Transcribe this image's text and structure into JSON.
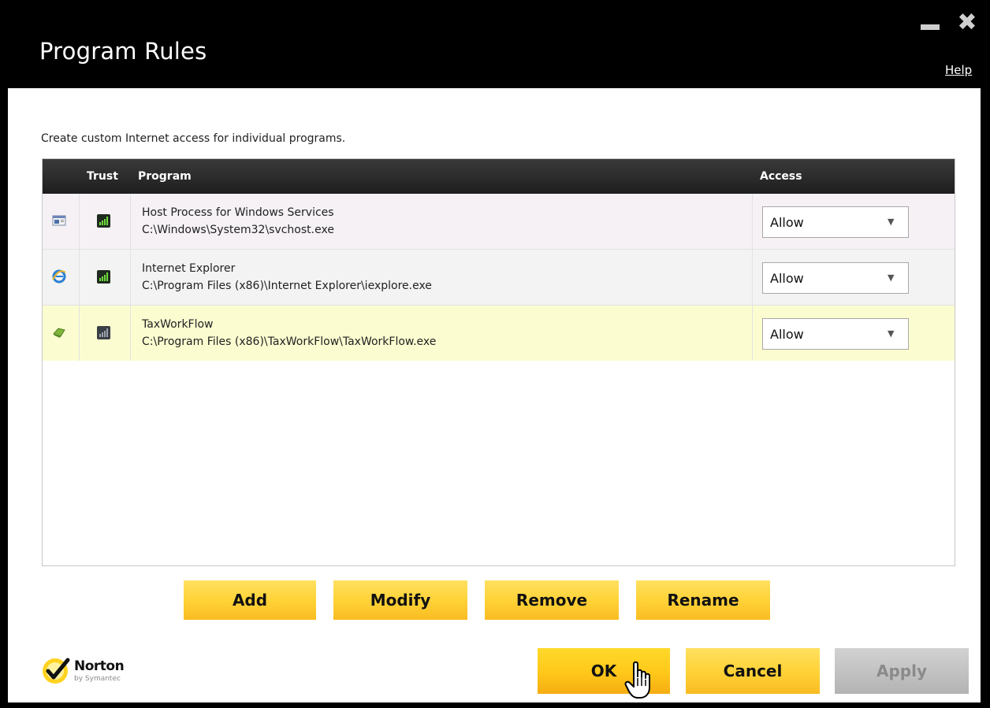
{
  "window": {
    "title": "Program Rules",
    "help_label": "Help",
    "minimize_label": "",
    "close_label": "✖"
  },
  "description": "Create custom Internet access for individual programs.",
  "table": {
    "columns": {
      "icon": "",
      "trust": "Trust",
      "program": "Program",
      "access": "Access"
    },
    "rows": [
      {
        "name": "Host Process for Windows Services",
        "path": "C:\\Windows\\System32\\svchost.exe",
        "program_icon": "window-icon",
        "trust_icon": "trust-green-icon",
        "access": "Allow"
      },
      {
        "name": "Internet Explorer",
        "path": "C:\\Program Files (x86)\\Internet Explorer\\iexplore.exe",
        "program_icon": "internet-explorer-icon",
        "trust_icon": "trust-green-icon",
        "access": "Allow"
      },
      {
        "name": "TaxWorkFlow",
        "path": "C:\\Program Files (x86)\\TaxWorkFlow\\TaxWorkFlow.exe",
        "program_icon": "taxworkflow-icon",
        "trust_icon": "trust-gray-icon",
        "access": "Allow"
      }
    ]
  },
  "actions": {
    "add": "Add",
    "modify": "Modify",
    "remove": "Remove",
    "rename": "Rename"
  },
  "footer": {
    "logo_text": "Norton",
    "logo_sub": "by Symantec",
    "ok": "OK",
    "cancel": "Cancel",
    "apply": "Apply"
  },
  "colors": {
    "title_bar": "#000000",
    "button_yellow": "#ffd338",
    "button_disabled": "#c4c4c4",
    "highlight_row": "#fbfdd0",
    "trust_green": "#3db52a"
  }
}
